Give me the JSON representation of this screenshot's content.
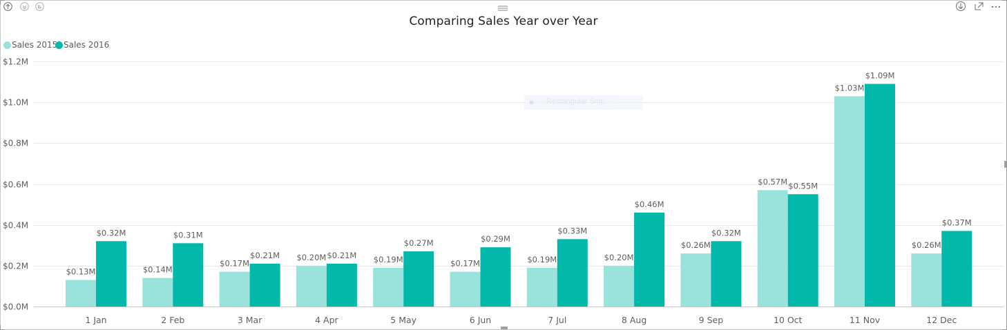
{
  "visual": {
    "title": "Comparing Sales Year over Year",
    "header_icons": [
      "drill-up-icon",
      "drill-down-all-icon",
      "expand-next-level-icon"
    ],
    "right_icons": [
      "drill-mode-icon",
      "focus-mode-icon",
      "more-options-icon"
    ],
    "overlay_text": "Rectangular Snip"
  },
  "colors": {
    "sales_2015": "#9ae3dc",
    "sales_2016": "#01b8aa",
    "grid": "#e6e6e6",
    "axis_text": "#605e5c",
    "label_text": "#605e5c"
  },
  "chart_data": {
    "type": "bar",
    "title": "Comparing Sales Year over Year",
    "xlabel": "",
    "ylabel": "",
    "legend_position": "top-left",
    "grid": true,
    "categories": [
      "1 Jan",
      "2 Feb",
      "3 Mar",
      "4 Apr",
      "5 May",
      "6 Jun",
      "7 Jul",
      "8 Aug",
      "9 Sep",
      "10 Oct",
      "11 Nov",
      "12 Dec"
    ],
    "series": [
      {
        "name": "Sales 2015",
        "values": [
          0.13,
          0.14,
          0.17,
          0.2,
          0.19,
          0.17,
          0.19,
          0.2,
          0.26,
          0.57,
          1.03,
          0.26
        ],
        "labels": [
          "$0.13M",
          "$0.14M",
          "$0.17M",
          "$0.20M",
          "$0.19M",
          "$0.17M",
          "$0.19M",
          "$0.20M",
          "$0.26M",
          "$0.57M",
          "$1.03M",
          "$0.26M"
        ]
      },
      {
        "name": "Sales 2016",
        "values": [
          0.32,
          0.31,
          0.21,
          0.21,
          0.27,
          0.29,
          0.33,
          0.46,
          0.32,
          0.55,
          1.09,
          0.37
        ],
        "labels": [
          "$0.32M",
          "$0.31M",
          "$0.21M",
          "$0.21M",
          "$0.27M",
          "$0.29M",
          "$0.33M",
          "$0.46M",
          "$0.32M",
          "$0.55M",
          "$1.09M",
          "$0.37M"
        ]
      }
    ],
    "ylim": [
      0,
      1.2
    ],
    "yticks": [
      0,
      0.2,
      0.4,
      0.6,
      0.8,
      1.0,
      1.2
    ],
    "ytick_labels": [
      "$0.0M",
      "$0.2M",
      "$0.4M",
      "$0.6M",
      "$0.8M",
      "$1.0M",
      "$1.2M"
    ]
  }
}
